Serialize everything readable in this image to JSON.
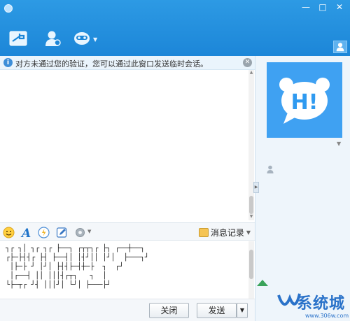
{
  "titlebar": {
    "window_controls": {
      "minimize": "—",
      "maximize": "□",
      "close": "✕"
    },
    "toolbar_icons": [
      "send-file-icon",
      "contact-icon",
      "remote-assist-icon"
    ]
  },
  "notice": {
    "text": "对方未通过您的验证，您可以通过此窗口发送临时会话。",
    "close": "✕"
  },
  "input_toolbar": {
    "icons": [
      "emoji-icon",
      "font-icon",
      "shake-icon",
      "edit-icon",
      "settings-icon"
    ],
    "history_label": "消息记录"
  },
  "input_area": {
    "ascii_art": "┐┌ ┐│ ┐┌ ┐┌ ├──┐ ┌┬┬┐┌ ├┐ ┌──┼──┐\n┌├─├┤┤┌ ├┤ ├──┤│ │┤┘││ │┘│  ├───┐┘\n │├─├ ┘ │┘│ ├┤┤├─┤┼─├  ┐  ┌┘\n │┌──┤ ││ │││┤┌┬┐   ┐  │\n└├─┬┌ ┘┤ │││┘│ └┘│ ├───├┘"
  },
  "buttons": {
    "close": "关闭",
    "send": "发送",
    "send_dropdown": "▼"
  },
  "right_panel": {
    "avatar_text": "H!",
    "colors": {
      "avatar_bg": "#3fa1f2",
      "title_bar": "#1f8ad9"
    }
  },
  "watermark": {
    "text": "系统城",
    "sub": "www.306w.com"
  }
}
